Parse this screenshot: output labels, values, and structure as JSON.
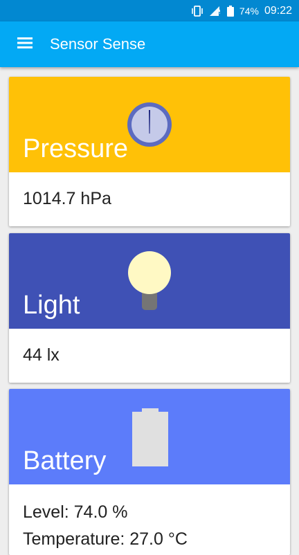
{
  "status_bar": {
    "battery_percent": "74%",
    "time": "09:22",
    "icons": [
      "vibrate-icon",
      "signal-icon",
      "battery-icon"
    ]
  },
  "app_bar": {
    "title": "Sensor Sense",
    "menu_icon": "menu-icon"
  },
  "cards": [
    {
      "title": "Pressure",
      "value": "1014.7 hPa",
      "color": "#ffc107",
      "icon": "gauge-icon"
    },
    {
      "title": "Light",
      "value": "44 lx",
      "color": "#3f51b5",
      "icon": "light-bulb-icon"
    },
    {
      "title": "Battery",
      "value": "Level: 74.0 %",
      "value2": "Temperature: 27.0 °C",
      "color": "#5c7cfa",
      "icon": "battery-icon"
    }
  ],
  "colors": {
    "status_bar": "#0288d1",
    "app_bar": "#03a9f4",
    "background": "#eeeeee"
  }
}
